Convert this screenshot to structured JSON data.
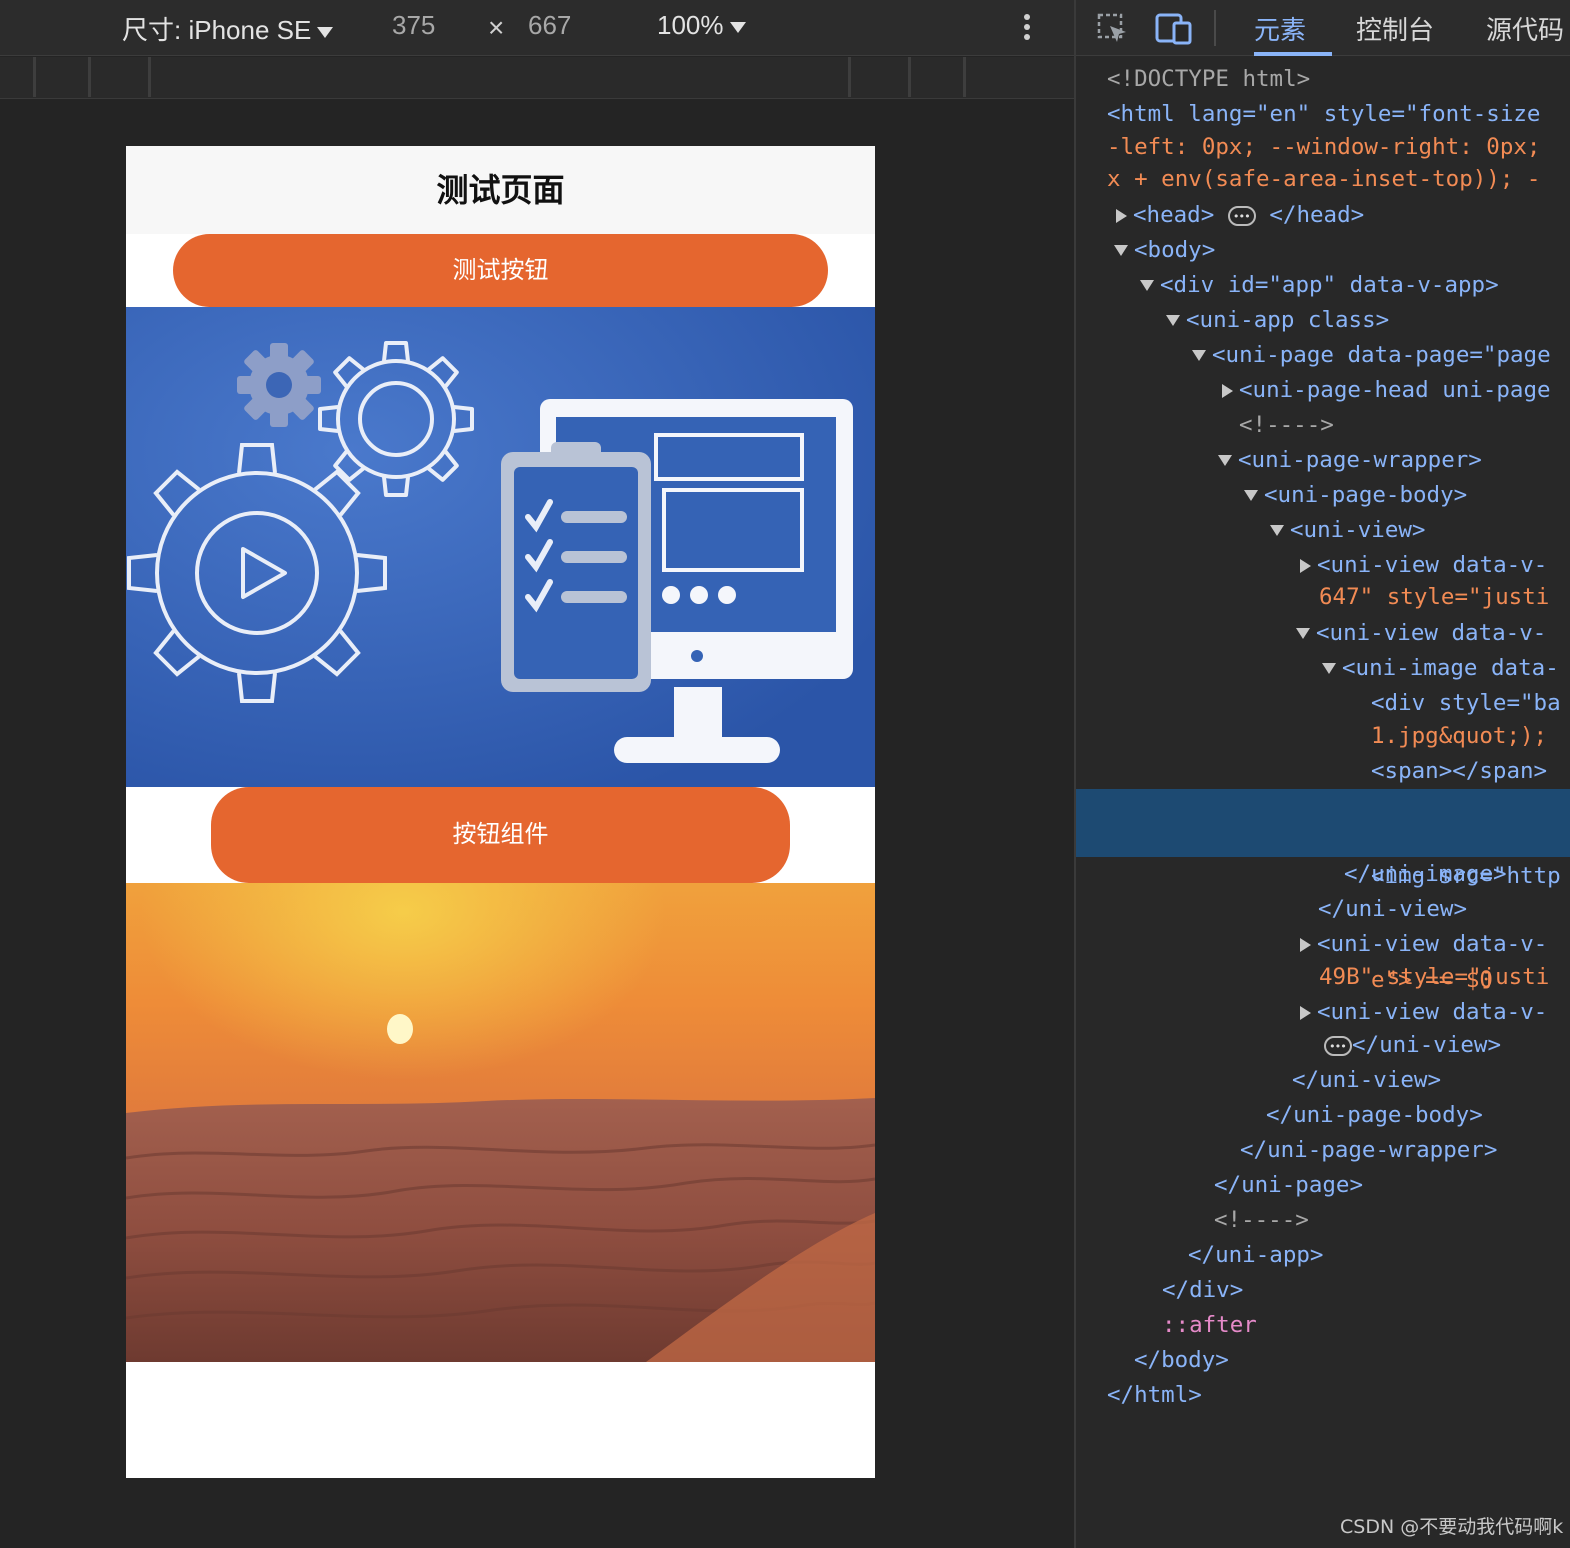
{
  "emulator_toolbar": {
    "device_label": "尺寸: iPhone SE",
    "width": "375",
    "times": "×",
    "height": "667",
    "zoom": "100%"
  },
  "page": {
    "nav_title": "测试页面",
    "button_primary": "测试按钮",
    "button_component": "按钮组件"
  },
  "devtools": {
    "tabs": [
      {
        "label": "元素"
      },
      {
        "label": "控制台"
      },
      {
        "label": "源代码"
      }
    ],
    "lines": [
      "<!DOCTYPE html>",
      "<html lang=\"en\" style=\"font-size",
      "-left: 0px; --window-right: 0px;",
      "x + env(safe-area-inset-top)); -",
      "<head>",
      "</head>",
      "<body>",
      "<div id=\"app\" data-v-app>",
      "<uni-app class>",
      "<uni-page data-page=\"page",
      "<uni-page-head uni-page",
      "<!---->",
      "<uni-page-wrapper>",
      "<uni-page-body>",
      "<uni-view>",
      "<uni-view data-v-",
      "647\" style=\"justi",
      "<uni-view data-v-",
      "<uni-image data-",
      "<div style=\"ba",
      "1.jpg&quot;);",
      "<span></span>",
      "<img src=\"http",
      "e\"> == $0",
      "</uni-image>",
      "</uni-view>",
      "<uni-view data-v-",
      "49B\" style=\"justi",
      "<uni-view data-v-",
      "</uni-view>",
      "</uni-view>",
      "</uni-page-body>",
      "</uni-page-wrapper>",
      "</uni-page>",
      "<!---->",
      "</uni-app>",
      "</div>",
      "::after",
      "</body>",
      "</html>"
    ]
  },
  "watermark": "CSDN @不要动我代码啊k",
  "colors": {
    "button": "#e5662f",
    "devtools_accent": "#8ab4f8",
    "selected_row": "#1d4a72"
  }
}
